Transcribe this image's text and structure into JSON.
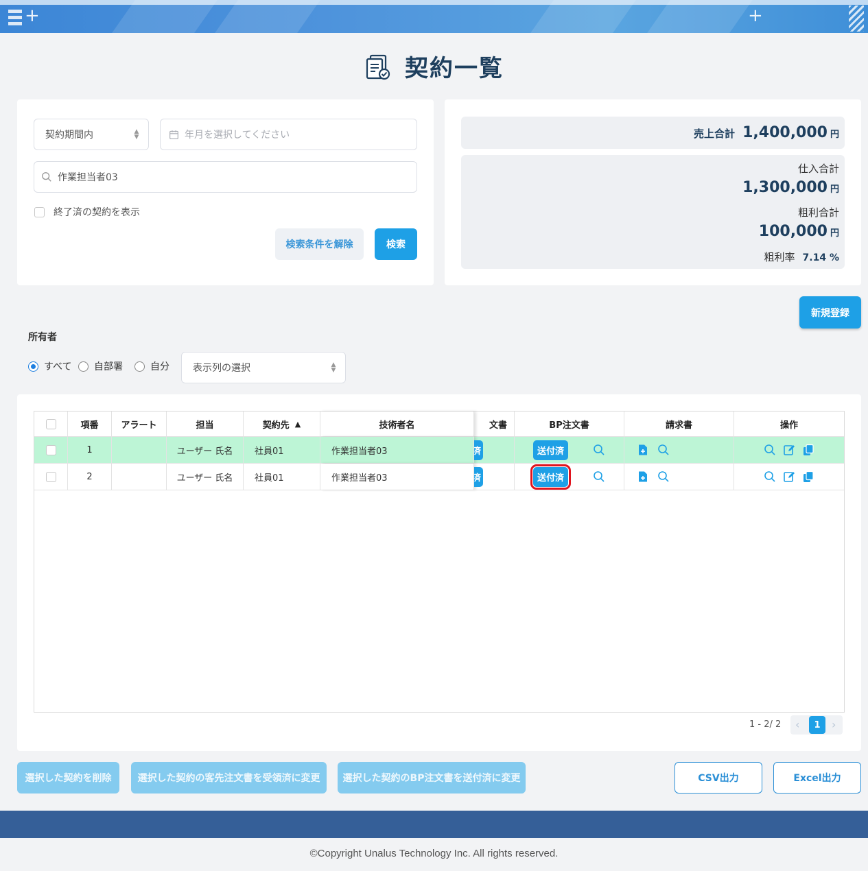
{
  "page": {
    "title": "契約一覧"
  },
  "search": {
    "period_select": "契約期間内",
    "month_placeholder": "年月を選択してください",
    "keyword_value": "作業担当者03",
    "show_finished_label": "終了済の契約を表示",
    "clear_button": "検索条件を解除",
    "search_button": "検索"
  },
  "summary": {
    "sales_label": "売上合計",
    "sales_value": "1,400,000",
    "purchase_label": "仕入合計",
    "purchase_value": "1,300,000",
    "profit_label": "粗利合計",
    "profit_value": "100,000",
    "margin_label": "粗利率",
    "margin_value": "7.14 %",
    "currency": "円"
  },
  "new_button": "新規登録",
  "owner": {
    "label": "所有者",
    "options": [
      "すべて",
      "自部署",
      "自分"
    ],
    "selected": "すべて",
    "columns_select": "表示列の選択"
  },
  "table": {
    "headers": {
      "no": "項番",
      "alert": "アラート",
      "person": "担当",
      "client": "契約先",
      "client_sort": "▲",
      "engineer": "技術者名",
      "partial": "文書",
      "bp_order": "BP注文書",
      "invoice": "請求書",
      "actions": "操作"
    },
    "rows": [
      {
        "no": "1",
        "alert": "",
        "person": "ユーザー 氏名",
        "client": "社員01",
        "engineer": "作業担当者03",
        "partial_tag": "済",
        "bp_status": "送付済",
        "highlight": true
      },
      {
        "no": "2",
        "alert": "",
        "person": "ユーザー 氏名",
        "client": "社員01",
        "engineer": "作業担当者03",
        "partial_tag": "済",
        "bp_status": "送付済",
        "highlight": false
      }
    ]
  },
  "pagination": {
    "range": "1 - 2/ 2",
    "current": "1",
    "prev": "‹",
    "next": "›"
  },
  "bottom_actions": {
    "delete": "選択した契約を削除",
    "client_received": "選択した契約の客先注文書を受領済に変更",
    "bp_sent": "選択した契約のBP注文書を送付済に変更",
    "csv": "CSV出力",
    "excel": "Excel出力"
  },
  "footer": {
    "copyright": "©Copyright Unalus Technology Inc. All rights reserved."
  },
  "colors": {
    "primary": "#1ea0e6",
    "header": "#4f94dc",
    "footer": "#355f98",
    "row_highlight": "#bdf5d6",
    "focus_red": "#e0141e"
  }
}
